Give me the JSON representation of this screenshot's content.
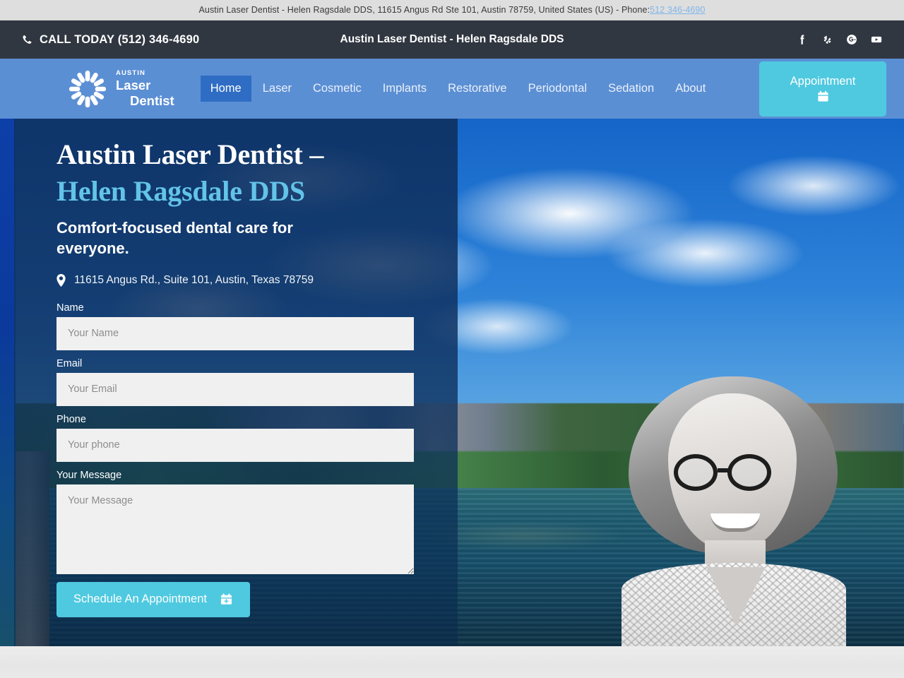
{
  "announce": {
    "text": "Austin Laser Dentist - Helen Ragsdale DDS, 11615 Angus Rd Ste 101, Austin 78759, United States (US) - Phone: ",
    "phone_link": "512 346-4690"
  },
  "topbar": {
    "call_label": "CALL TODAY (512) 346-4690",
    "site_title": "Austin Laser Dentist - Helen Ragsdale DDS",
    "phone_icon": "phone-icon",
    "socials": [
      {
        "name": "facebook-icon",
        "label": "Facebook"
      },
      {
        "name": "yelp-icon",
        "label": "Yelp"
      },
      {
        "name": "google-plus-icon",
        "label": "Google Plus"
      },
      {
        "name": "youtube-icon",
        "label": "YouTube"
      }
    ]
  },
  "nav": {
    "logo": {
      "icon": "starburst-logo-icon",
      "line1": "AUSTIN",
      "line2": "Laser",
      "line3": "Dentist"
    },
    "items": [
      {
        "label": "Home",
        "active": true
      },
      {
        "label": "Laser",
        "active": false
      },
      {
        "label": "Cosmetic",
        "active": false
      },
      {
        "label": "Implants",
        "active": false
      },
      {
        "label": "Restorative",
        "active": false
      },
      {
        "label": "Periodontal",
        "active": false
      },
      {
        "label": "Sedation",
        "active": false
      },
      {
        "label": "About",
        "active": false
      }
    ],
    "appointment_button": {
      "label": "Appointment",
      "icon": "calendar-icon"
    }
  },
  "hero": {
    "heading_line1": "Austin Laser Dentist –",
    "heading_line2": "Helen Ragsdale DDS",
    "subheading": "Comfort-focused dental care for everyone.",
    "address": "11615 Angus Rd., Suite 101, Austin, Texas 78759",
    "address_icon": "map-pin-icon",
    "form": {
      "name_label": "Name",
      "name_placeholder": "Your Name",
      "name_value": "",
      "email_label": "Email",
      "email_placeholder": "Your Email",
      "email_value": "",
      "phone_label": "Phone",
      "phone_placeholder": "Your phone",
      "phone_value": "",
      "message_label": "Your Message",
      "message_placeholder": "Your Message",
      "message_value": "",
      "submit_label": "Schedule An Appointment",
      "submit_icon": "calendar-plus-icon"
    }
  },
  "colors": {
    "announce_bg": "#dedede",
    "topbar_bg": "#313741",
    "nav_bg": "#5b8fd4",
    "nav_active_bg": "#2f6dc4",
    "accent_cyan": "#4fc9e0",
    "heading_accent": "#63c3e8",
    "link_blue": "#7fb6e8",
    "field_bg": "#f0f0f0"
  }
}
